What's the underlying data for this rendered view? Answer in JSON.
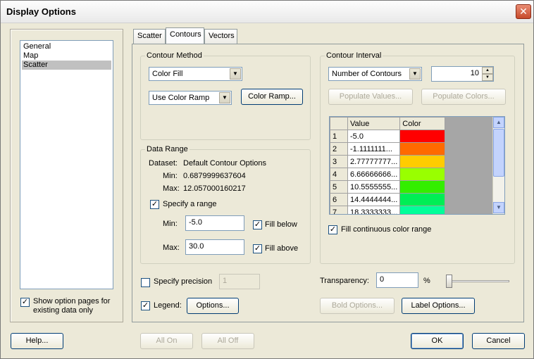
{
  "window": {
    "title": "Display Options",
    "close_glyph": "✕"
  },
  "left": {
    "items": [
      "General",
      "Map",
      "Scatter"
    ],
    "selected_index": 2,
    "show_existing_label": "Show option pages for existing data only",
    "show_existing_checked": true
  },
  "tabs": [
    {
      "label": "Scatter",
      "active": false
    },
    {
      "label": "Contours",
      "active": true
    },
    {
      "label": "Vectors",
      "active": false
    }
  ],
  "contour_method": {
    "group_label": "Contour Method",
    "method_value": "Color Fill",
    "ramp_value": "Use Color Ramp",
    "color_ramp_button": "Color Ramp..."
  },
  "data_range": {
    "group_label": "Data Range",
    "dataset_label": "Dataset:",
    "dataset_value": "Default Contour Options",
    "min_label": "Min:",
    "min_value": "0.6879999637604",
    "max_label": "Max:",
    "max_value": "12.057000160217",
    "specify_range_label": "Specify a range",
    "specify_range_checked": true,
    "range_min_label": "Min:",
    "range_min_value": "-5.0",
    "range_max_label": "Max:",
    "range_max_value": "30.0",
    "fill_below_label": "Fill below",
    "fill_below_checked": true,
    "fill_above_label": "Fill above",
    "fill_above_checked": true
  },
  "contour_interval": {
    "group_label": "Contour Interval",
    "type_value": "Number of Contours",
    "count_value": "10",
    "populate_values_button": "Populate Values...",
    "populate_colors_button": "Populate Colors...",
    "grid_headers": [
      "",
      "Value",
      "Color"
    ],
    "rows": [
      {
        "index": "1",
        "value": "-5.0",
        "color": "#ff0000"
      },
      {
        "index": "2",
        "value": "-1.1111111...",
        "color": "#ff6a00"
      },
      {
        "index": "3",
        "value": "2.77777777...",
        "color": "#ffcc00"
      },
      {
        "index": "4",
        "value": "6.66666666...",
        "color": "#99ff00"
      },
      {
        "index": "5",
        "value": "10.5555555...",
        "color": "#33ee00"
      },
      {
        "index": "6",
        "value": "14.4444444...",
        "color": "#00ee55"
      },
      {
        "index": "7",
        "value": "18.3333333...",
        "color": "#00ff99"
      }
    ],
    "fill_continuous_label": "Fill continuous color range",
    "fill_continuous_checked": true
  },
  "precision": {
    "label": "Specify precision",
    "checked": false,
    "value": "1"
  },
  "transparency": {
    "label": "Transparency:",
    "value": "0",
    "unit": "%",
    "level": 0
  },
  "legend": {
    "label": "Legend:",
    "checked": true,
    "options_button": "Options..."
  },
  "bold_options_button": "Bold Options...",
  "label_options_button": "Label Options...",
  "footer": {
    "help": "Help...",
    "all_on": "All On",
    "all_off": "All Off",
    "ok": "OK",
    "cancel": "Cancel"
  },
  "colors": {
    "title_close": "#c74a2b",
    "dialog_bg": "#ece9d8",
    "selection": "#c0c0c0"
  },
  "icons": {
    "close": "close-icon",
    "dropdown": "chevron-down-icon",
    "check": "check-icon"
  }
}
